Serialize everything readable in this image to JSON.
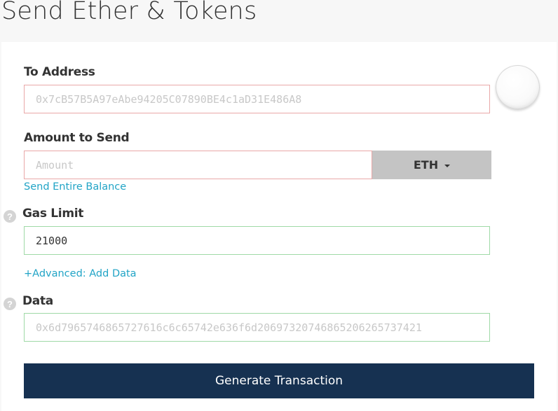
{
  "header": {
    "title": "Send Ether & Tokens"
  },
  "to_address": {
    "label": "To Address",
    "placeholder": "0x7cB57B5A97eAbe94205C07890BE4c1aD31E486A8"
  },
  "amount": {
    "label": "Amount to Send",
    "placeholder": "Amount",
    "unit": "ETH",
    "send_entire_balance": "Send Entire Balance"
  },
  "gas_limit": {
    "label": "Gas Limit",
    "value": "21000",
    "help": "?"
  },
  "advanced": {
    "label": "+Advanced: Add Data"
  },
  "data_field": {
    "label": "Data",
    "placeholder": "0x6d7965746865727616c6c65742e636f6d20697320746865206265737421",
    "help": "?"
  },
  "actions": {
    "generate_label": "Generate Transaction"
  },
  "colors": {
    "primary": "#163151",
    "link": "#21a4c6",
    "invalid_border": "#e9a8a8",
    "valid_border": "#9fd9a6",
    "unit_button_bg": "#c4c4c4"
  }
}
